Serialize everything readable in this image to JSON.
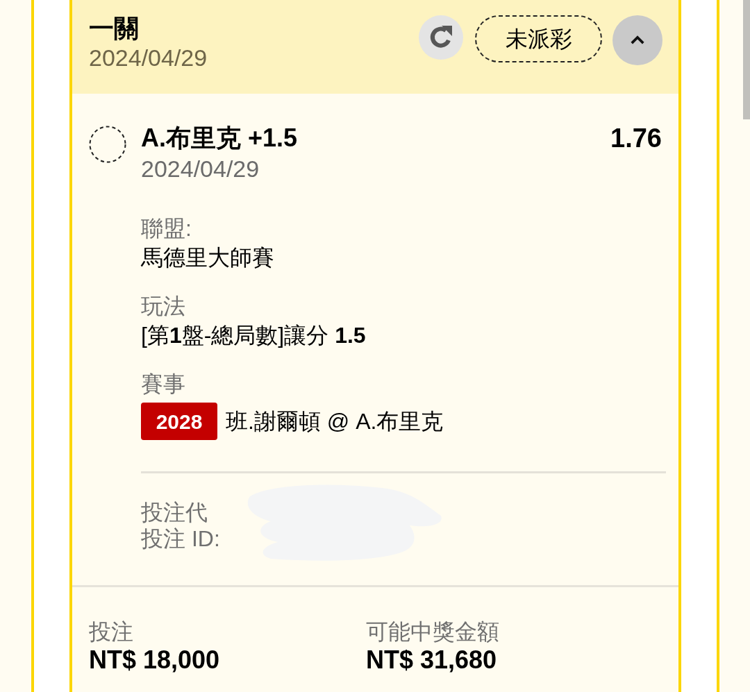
{
  "bet_card": {
    "header": {
      "title": "一關",
      "date": "2024/04/29",
      "status": "未派彩",
      "expanded": true
    },
    "selection": {
      "name": "A.布里克 +1.5",
      "date": "2024/04/29",
      "odds": "1.76"
    },
    "details": [
      {
        "label": "聯盟:",
        "value": "馬德里大師賽"
      },
      {
        "label": "玩法",
        "value": "[第**1**盤-總局數]讓分 **1.5**"
      },
      {
        "label": "賽事",
        "badge": "2028",
        "value": "班.謝爾頓 @ A.布里克"
      }
    ],
    "references": [
      "投注代",
      "投注 ID:"
    ],
    "summary": [
      {
        "label": "投注",
        "value": "NT$ 18,000"
      },
      {
        "label": "可能中獎金額",
        "value": "NT$ 31,680"
      }
    ]
  }
}
